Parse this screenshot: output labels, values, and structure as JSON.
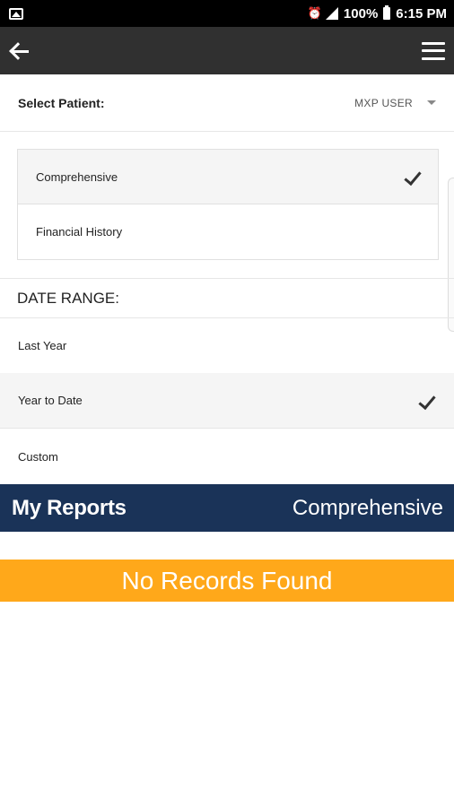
{
  "status_bar": {
    "battery_percent": "100%",
    "time": "6:15 PM",
    "icons": [
      "gallery-icon",
      "alarm-icon",
      "signal-icon",
      "battery-icon"
    ]
  },
  "app_bar": {
    "back_icon": "arrow-left",
    "menu_icon": "hamburger"
  },
  "patient": {
    "label": "Select Patient:",
    "selected": "MXP USER"
  },
  "report_types": {
    "items": [
      {
        "label": "Comprehensive",
        "selected": true
      },
      {
        "label": "Financial History",
        "selected": false
      }
    ]
  },
  "date_range": {
    "title": "DATE RANGE:",
    "items": [
      {
        "label": "Last Year",
        "selected": false
      },
      {
        "label": "Year to Date",
        "selected": true
      },
      {
        "label": "Custom",
        "selected": false
      }
    ]
  },
  "reports_bar": {
    "title": "My Reports",
    "type": "Comprehensive"
  },
  "no_records": {
    "text": "No Records Found"
  },
  "colors": {
    "app_bar": "#303030",
    "reports_bar": "#1a3358",
    "no_records": "#ffa81a"
  }
}
